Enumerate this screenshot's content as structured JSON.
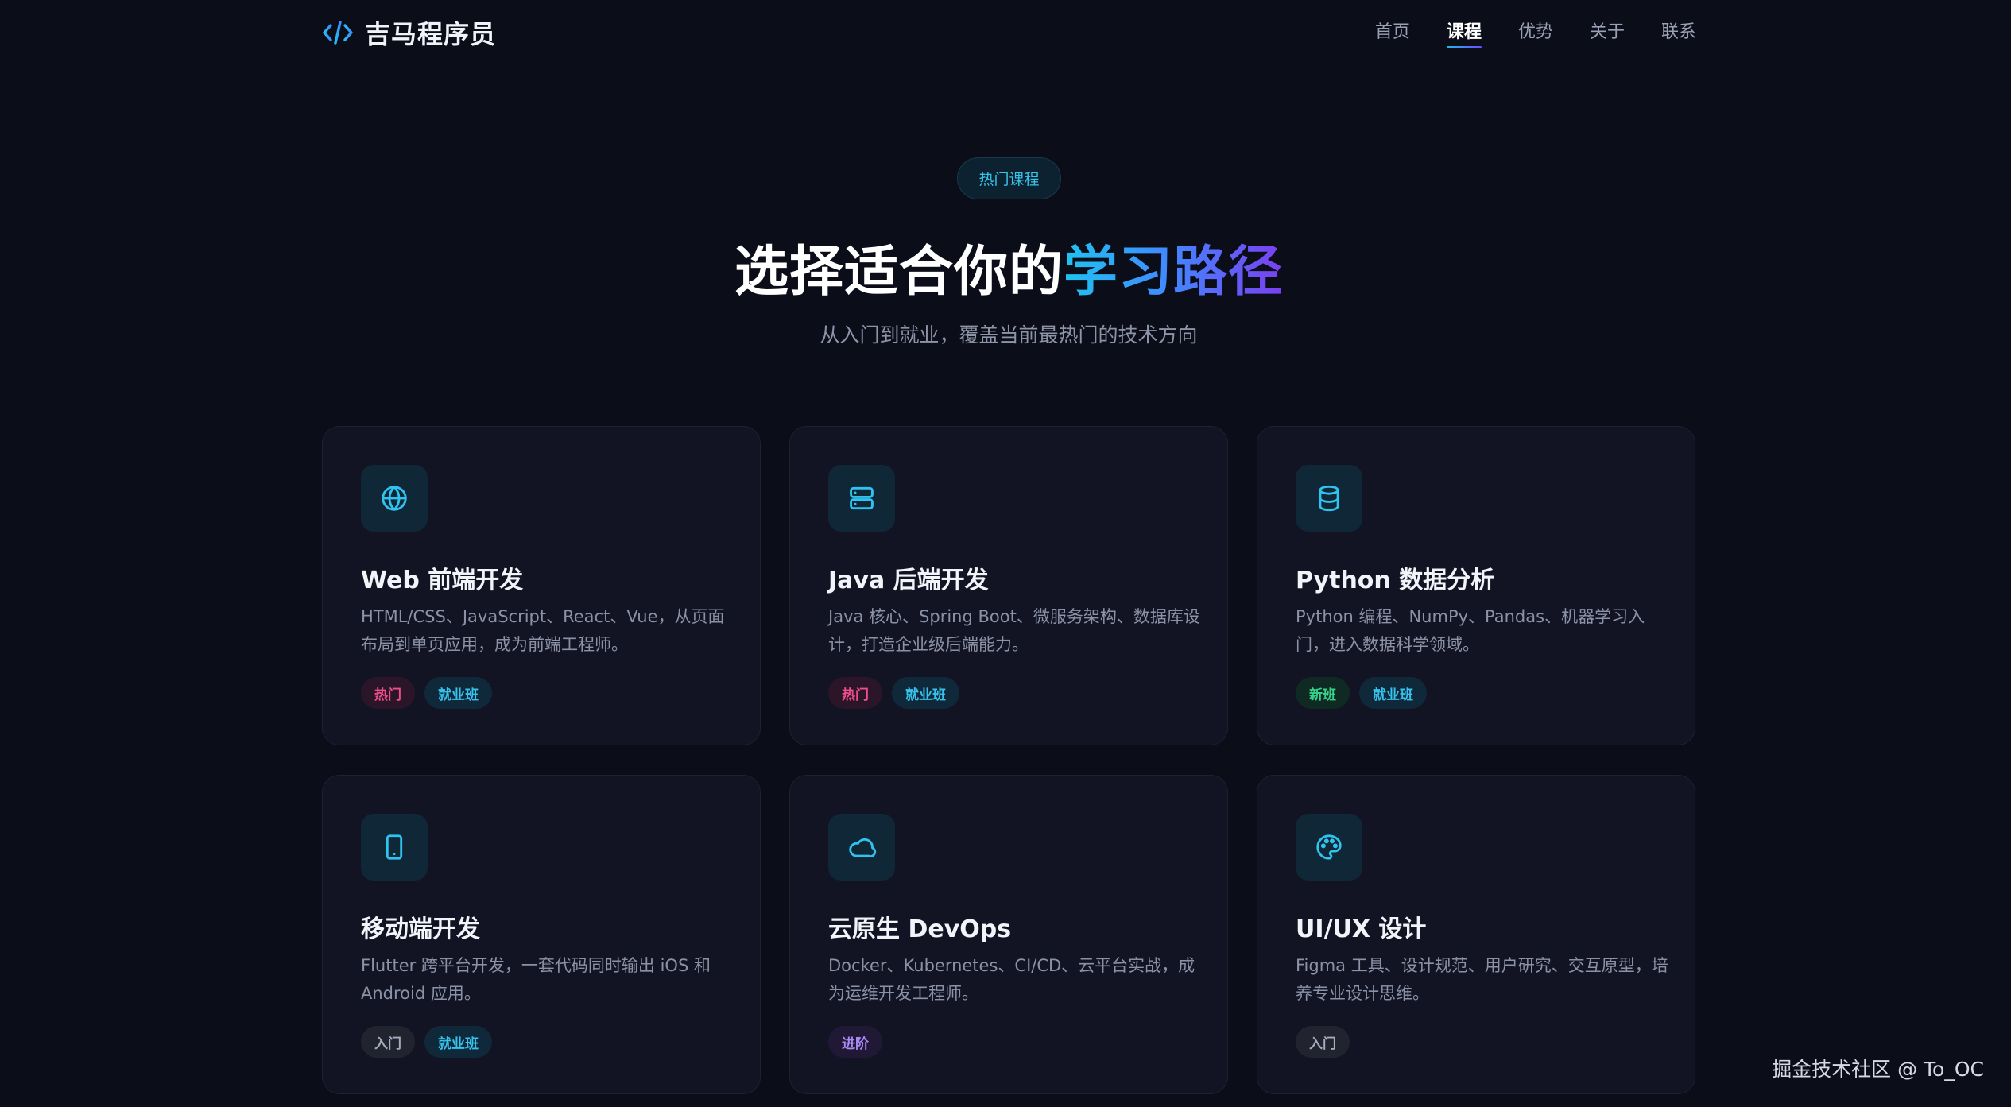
{
  "header": {
    "logo_text": "吉马程序员",
    "nav": [
      {
        "label": "首页",
        "active": false
      },
      {
        "label": "课程",
        "active": true
      },
      {
        "label": "优势",
        "active": false
      },
      {
        "label": "关于",
        "active": false
      },
      {
        "label": "联系",
        "active": false
      }
    ]
  },
  "hero": {
    "badge": "热门课程",
    "title_plain": "选择适合你的",
    "title_highlight": "学习路径",
    "subtitle": "从入门到就业，覆盖当前最热门的技术方向"
  },
  "courses": [
    {
      "icon": "globe-icon",
      "title": "Web 前端开发",
      "desc": "HTML/CSS、JavaScript、React、Vue，从页面布局到单页应用，成为前端工程师。",
      "tags": [
        {
          "label": "热门",
          "kind": "hot"
        },
        {
          "label": "就业班",
          "kind": "job"
        }
      ]
    },
    {
      "icon": "server-icon",
      "title": "Java 后端开发",
      "desc": "Java 核心、Spring Boot、微服务架构、数据库设计，打造企业级后端能力。",
      "tags": [
        {
          "label": "热门",
          "kind": "hot"
        },
        {
          "label": "就业班",
          "kind": "job"
        }
      ]
    },
    {
      "icon": "database-icon",
      "title": "Python 数据分析",
      "desc": "Python 编程、NumPy、Pandas、机器学习入门，进入数据科学领域。",
      "tags": [
        {
          "label": "新班",
          "kind": "new"
        },
        {
          "label": "就业班",
          "kind": "job"
        }
      ]
    },
    {
      "icon": "smartphone-icon",
      "title": "移动端开发",
      "desc": "Flutter 跨平台开发，一套代码同时输出 iOS 和 Android 应用。",
      "tags": [
        {
          "label": "入门",
          "kind": "intro"
        },
        {
          "label": "就业班",
          "kind": "job"
        }
      ]
    },
    {
      "icon": "cloud-icon",
      "title": "云原生 DevOps",
      "desc": "Docker、Kubernetes、CI/CD、云平台实战，成为运维开发工程师。",
      "tags": [
        {
          "label": "进阶",
          "kind": "adv"
        }
      ]
    },
    {
      "icon": "palette-icon",
      "title": "UI/UX 设计",
      "desc": "Figma 工具、设计规范、用户研究、交互原型，培养专业设计思维。",
      "tags": [
        {
          "label": "入门",
          "kind": "intro"
        }
      ]
    }
  ],
  "watermark": "掘金技术社区 @ To_OC"
}
